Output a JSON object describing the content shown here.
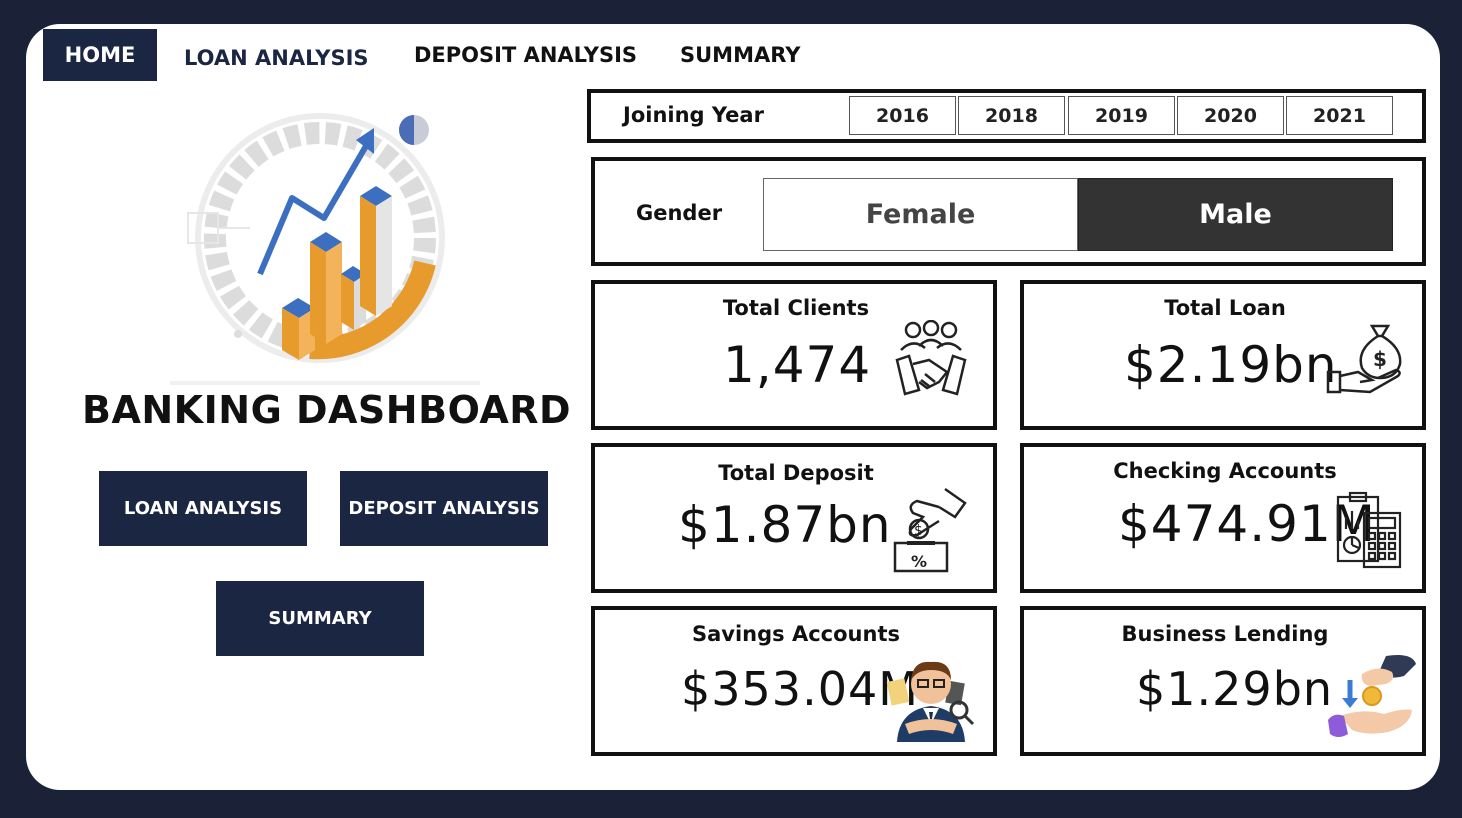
{
  "nav": {
    "tabs": [
      {
        "label": "HOME"
      },
      {
        "label": "LOAN ANALYSIS"
      },
      {
        "label": "DEPOSIT ANALYSIS"
      },
      {
        "label": "SUMMARY"
      }
    ]
  },
  "left": {
    "title": "BANKING DASHBOARD",
    "buttons": {
      "loan": "LOAN ANALYSIS",
      "deposit": "DEPOSIT ANALYSIS",
      "summary": "SUMMARY"
    }
  },
  "filters": {
    "joining_year_label": "Joining Year",
    "years": [
      "2016",
      "2018",
      "2019",
      "2020",
      "2021"
    ],
    "gender_label": "Gender",
    "genders": [
      "Female",
      "Male"
    ],
    "selected_gender": "Male"
  },
  "kpis": {
    "total_clients": {
      "title": "Total Clients",
      "value": "1,474",
      "icon": "handshake-people-icon"
    },
    "total_loan": {
      "title": "Total Loan",
      "value": "$2.19bn",
      "icon": "money-bag-hand-icon"
    },
    "total_deposit": {
      "title": "Total Deposit",
      "value": "$1.87bn",
      "icon": "deposit-box-icon"
    },
    "checking_accounts": {
      "title": "Checking Accounts",
      "value": "$474.91M",
      "icon": "calculator-report-icon"
    },
    "savings_accounts": {
      "title": "Savings Accounts",
      "value": "$353.04M",
      "icon": "accountant-icon"
    },
    "business_lending": {
      "title": "Business Lending",
      "value": "$1.29bn",
      "icon": "coin-lending-hands-icon"
    }
  },
  "colors": {
    "background": "#1b2238",
    "nav_dark": "#1b2643",
    "bar_orange": "#e79b2d",
    "bar_blue": "#3c6fbf",
    "male_selected": "#333333"
  }
}
